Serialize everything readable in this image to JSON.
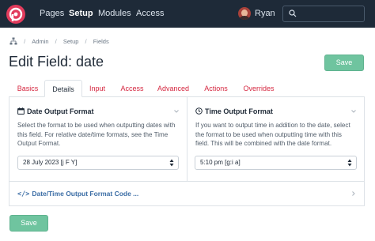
{
  "nav": {
    "items": [
      {
        "label": "Pages",
        "active": false
      },
      {
        "label": "Setup",
        "active": true
      },
      {
        "label": "Modules",
        "active": false
      },
      {
        "label": "Access",
        "active": false
      }
    ],
    "user": "Ryan",
    "search_placeholder": "",
    "brand_color": "#e23b5c"
  },
  "breadcrumb": [
    "Admin",
    "Setup",
    "Fields"
  ],
  "page_title": "Edit Field: date",
  "save_label": "Save",
  "tabs": [
    {
      "label": "Basics",
      "active": false
    },
    {
      "label": "Details",
      "active": true
    },
    {
      "label": "Input",
      "active": false
    },
    {
      "label": "Access",
      "active": false
    },
    {
      "label": "Advanced",
      "active": false
    },
    {
      "label": "Actions",
      "active": false
    },
    {
      "label": "Overrides",
      "active": false
    }
  ],
  "date_format": {
    "title": "Date Output Format",
    "description": "Select the format to be used when outputting dates with this field. For relative date/time formats, see the Time Output Format.",
    "selected": "28 July 2023 [j F Y]"
  },
  "time_format": {
    "title": "Time Output Format",
    "description": "If you want to output time in addition to the date, select the format to be used when outputting time with this field. This will be combined with the date format.",
    "selected": "5:10 pm [g:i a]"
  },
  "code_section": {
    "title": "Date/Time Output Format Code ..."
  },
  "colors": {
    "nav_bg": "#1e2a38",
    "save_bg": "#6fc49f",
    "tab_link": "#d5263f",
    "code_link": "#3c6ea6"
  }
}
